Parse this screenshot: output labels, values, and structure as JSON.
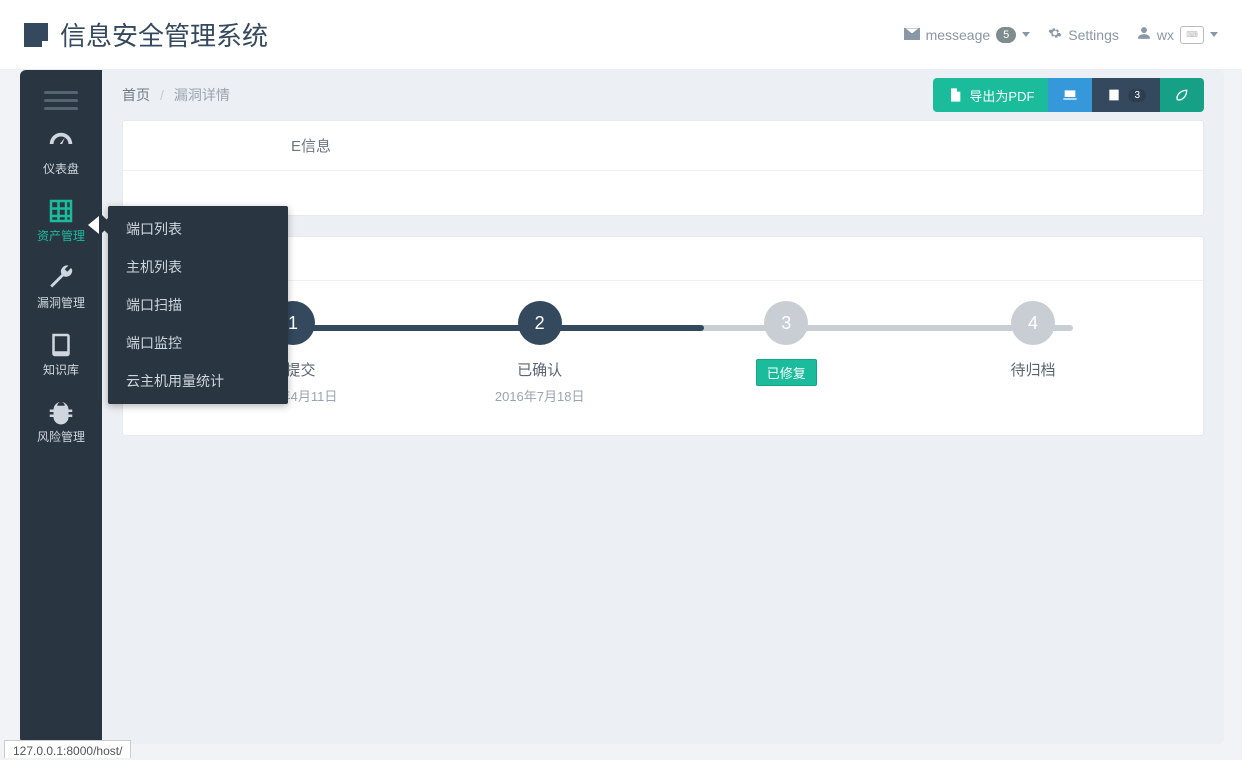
{
  "brand": {
    "title": "信息安全管理系统"
  },
  "topnav": {
    "message_label": "messeage",
    "message_count": "5",
    "settings_label": "Settings",
    "user_label": "wx"
  },
  "sidebar": {
    "items": [
      {
        "label": "仪表盘"
      },
      {
        "label": "资产管理"
      },
      {
        "label": "漏洞管理"
      },
      {
        "label": "知识库"
      },
      {
        "label": "风险管理"
      }
    ]
  },
  "submenu": {
    "items": [
      {
        "label": "端口列表"
      },
      {
        "label": "主机列表"
      },
      {
        "label": "端口扫描"
      },
      {
        "label": "端口监控"
      },
      {
        "label": "云主机用量统计"
      }
    ]
  },
  "breadcrumb": {
    "home": "首页",
    "current": "漏洞详情"
  },
  "actions": {
    "export_pdf": "导出为PDF",
    "cal_badge": "3"
  },
  "panel1": {
    "header_fragment": "E信息"
  },
  "stepper": {
    "steps": [
      {
        "num": "1",
        "label": "已提交",
        "date": "2016年4月11日",
        "done": true
      },
      {
        "num": "2",
        "label": "已确认",
        "date": "2016年7月18日",
        "done": true
      },
      {
        "num": "3",
        "label": "",
        "badge": "已修复",
        "done": false
      },
      {
        "num": "4",
        "label": "待归档",
        "done": false
      }
    ],
    "progress_percent": 55
  },
  "statusbar": {
    "text": "127.0.0.1:8000/host/"
  }
}
